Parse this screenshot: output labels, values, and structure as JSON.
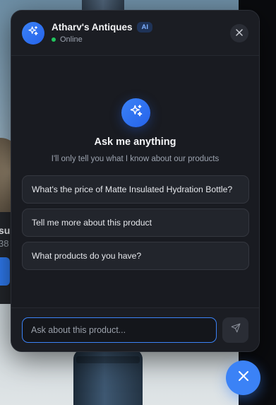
{
  "background": {
    "product_name_fragment": "su",
    "product_price_fragment": "38"
  },
  "chat": {
    "header": {
      "store_name": "Atharv's Antiques",
      "badge": "AI",
      "status": "Online",
      "avatar_icon": "sparkles-icon",
      "close_icon": "close-icon"
    },
    "welcome": {
      "icon": "sparkles-icon",
      "title": "Ask me anything",
      "subtitle": "I'll only tell you what I know about our products"
    },
    "suggestions": [
      {
        "label": "What's the price of Matte Insulated Hydration Bottle?"
      },
      {
        "label": "Tell me more about this product"
      },
      {
        "label": "What products do you have?"
      }
    ],
    "input": {
      "placeholder": "Ask about this product...",
      "value": ""
    },
    "send_icon": "send-icon"
  },
  "launcher": {
    "icon": "close-icon"
  },
  "colors": {
    "accent": "#3b82f6",
    "panel_bg": "#191b21",
    "status_online": "#22c55e",
    "badge_text": "#7fb0ff"
  }
}
